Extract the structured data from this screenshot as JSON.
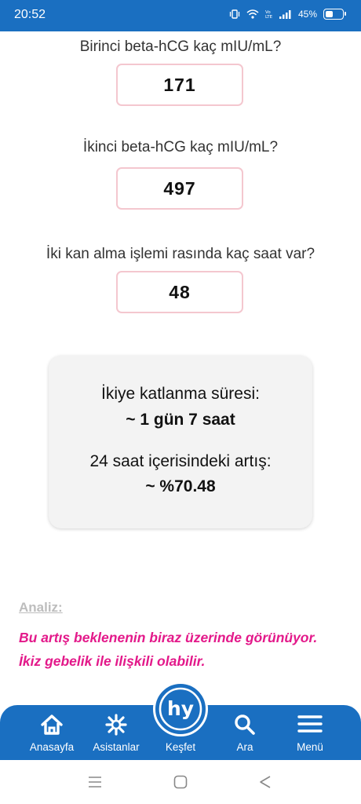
{
  "status_bar": {
    "time": "20:52",
    "battery_percent": "45%"
  },
  "questions": [
    {
      "label": "Birinci beta-hCG kaç mIU/mL?",
      "value": "171"
    },
    {
      "label": "İkinci beta-hCG kaç mIU/mL?",
      "value": "497"
    },
    {
      "label": "İki kan alma işlemi rasında kaç saat var?",
      "value": "48"
    }
  ],
  "result": {
    "doubling_label": "İkiye katlanma süresi:",
    "doubling_value": "~ 1 gün 7 saat",
    "increase_label": "24 saat içerisindeki artış:",
    "increase_value": "~ %70.48"
  },
  "analysis": {
    "title": "Analiz:",
    "line1": "Bu artış beklenenin biraz üzerinde görünüyor.",
    "line2": "İkiz gebelik ile ilişkili olabilir."
  },
  "bottom_nav": {
    "items": [
      {
        "label": "Anasayfa",
        "icon": "home-icon"
      },
      {
        "label": "Asistanlar",
        "icon": "assistants-icon"
      },
      {
        "label": "Keşfet",
        "icon": "hy-logo-icon"
      },
      {
        "label": "Ara",
        "icon": "search-icon"
      },
      {
        "label": "Menü",
        "icon": "hamburger-menu-icon"
      }
    ],
    "center_logo_text": "hy"
  },
  "colors": {
    "brand_blue": "#1a6fc1",
    "analysis_pink": "#e3198a",
    "box_border": "#f4c7cf"
  }
}
